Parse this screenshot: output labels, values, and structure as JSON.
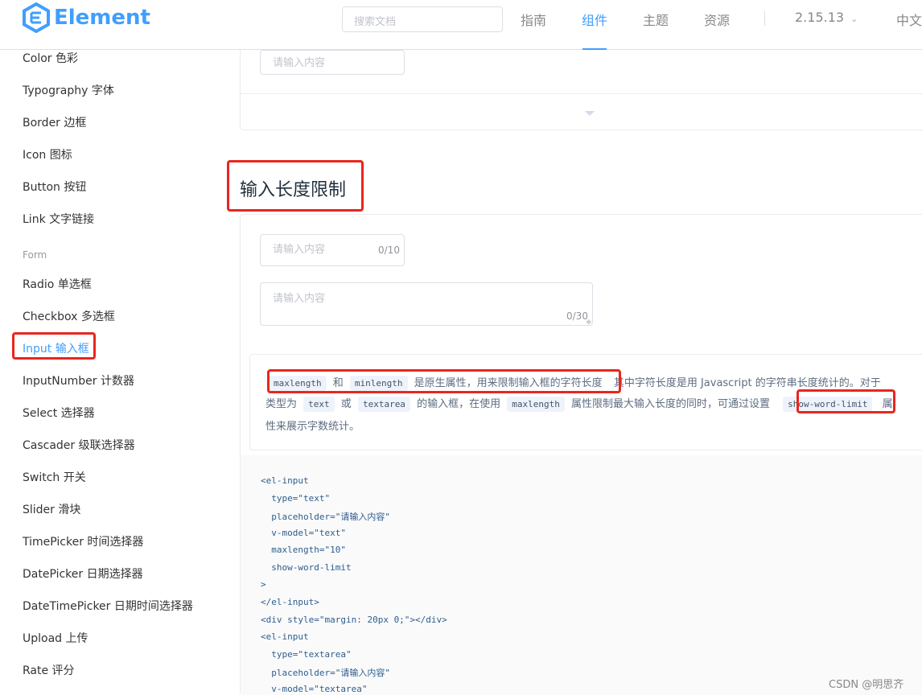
{
  "header": {
    "logo_text": "Element",
    "search_placeholder": "搜索文档",
    "nav": [
      "指南",
      "组件",
      "主题",
      "资源"
    ],
    "active_nav": "组件",
    "version": "2.15.13",
    "lang": "中文"
  },
  "sidebar": {
    "items_top": [
      "Color 色彩",
      "Typography 字体",
      "Border 边框",
      "Icon 图标",
      "Button 按钮",
      "Link 文字链接"
    ],
    "group_label": "Form",
    "items_form": [
      "Radio 单选框",
      "Checkbox 多选框",
      "Input 输入框",
      "InputNumber 计数器",
      "Select 选择器",
      "Cascader 级联选择器",
      "Switch 开关",
      "Slider 滑块",
      "TimePicker 时间选择器",
      "DatePicker 日期选择器",
      "DateTimePicker 日期时间选择器",
      "Upload 上传",
      "Rate 评分"
    ],
    "active_item": "Input 输入框"
  },
  "content": {
    "top_input_placeholder": "请输入内容",
    "section_title": "输入长度限制",
    "input_placeholder": "请输入内容",
    "input_count": "0/10",
    "textarea_placeholder": "请输入内容",
    "textarea_count": "0/30",
    "desc": {
      "code_maxlength": "maxlength",
      "and": "和",
      "code_minlength": "minlength",
      "native_text": "是原生属性，用来限制输入框的字符长度",
      "rest1": "其中字符长度是用 Javascript 的字符串长度统计的。对于",
      "type_prefix": "类型为",
      "code_text": "text",
      "or": "或",
      "code_textarea": "textarea",
      "mid_text": "的输入框，在使用",
      "code_maxlength2": "maxlength",
      "mid_text2": "属性限制最大输入长度的同时，可通过设置",
      "code_swl": "show-word-limit",
      "attr_char": "属",
      "line3": "性来展示字数统计。"
    },
    "code_lines": [
      "<el-input",
      "  type=\"text\"",
      "  placeholder=\"请输入内容\"",
      "  v-model=\"text\"",
      "  maxlength=\"10\"",
      "  show-word-limit",
      ">",
      "</el-input>",
      "<div style=\"margin: 20px 0;\"></div>",
      "<el-input",
      "  type=\"textarea\"",
      "  placeholder=\"请输入内容\"",
      "  v-model=\"textarea\""
    ]
  },
  "watermark": "CSDN @明思齐",
  "colors": {
    "accent": "#409eff",
    "highlight": "#e8261e"
  }
}
